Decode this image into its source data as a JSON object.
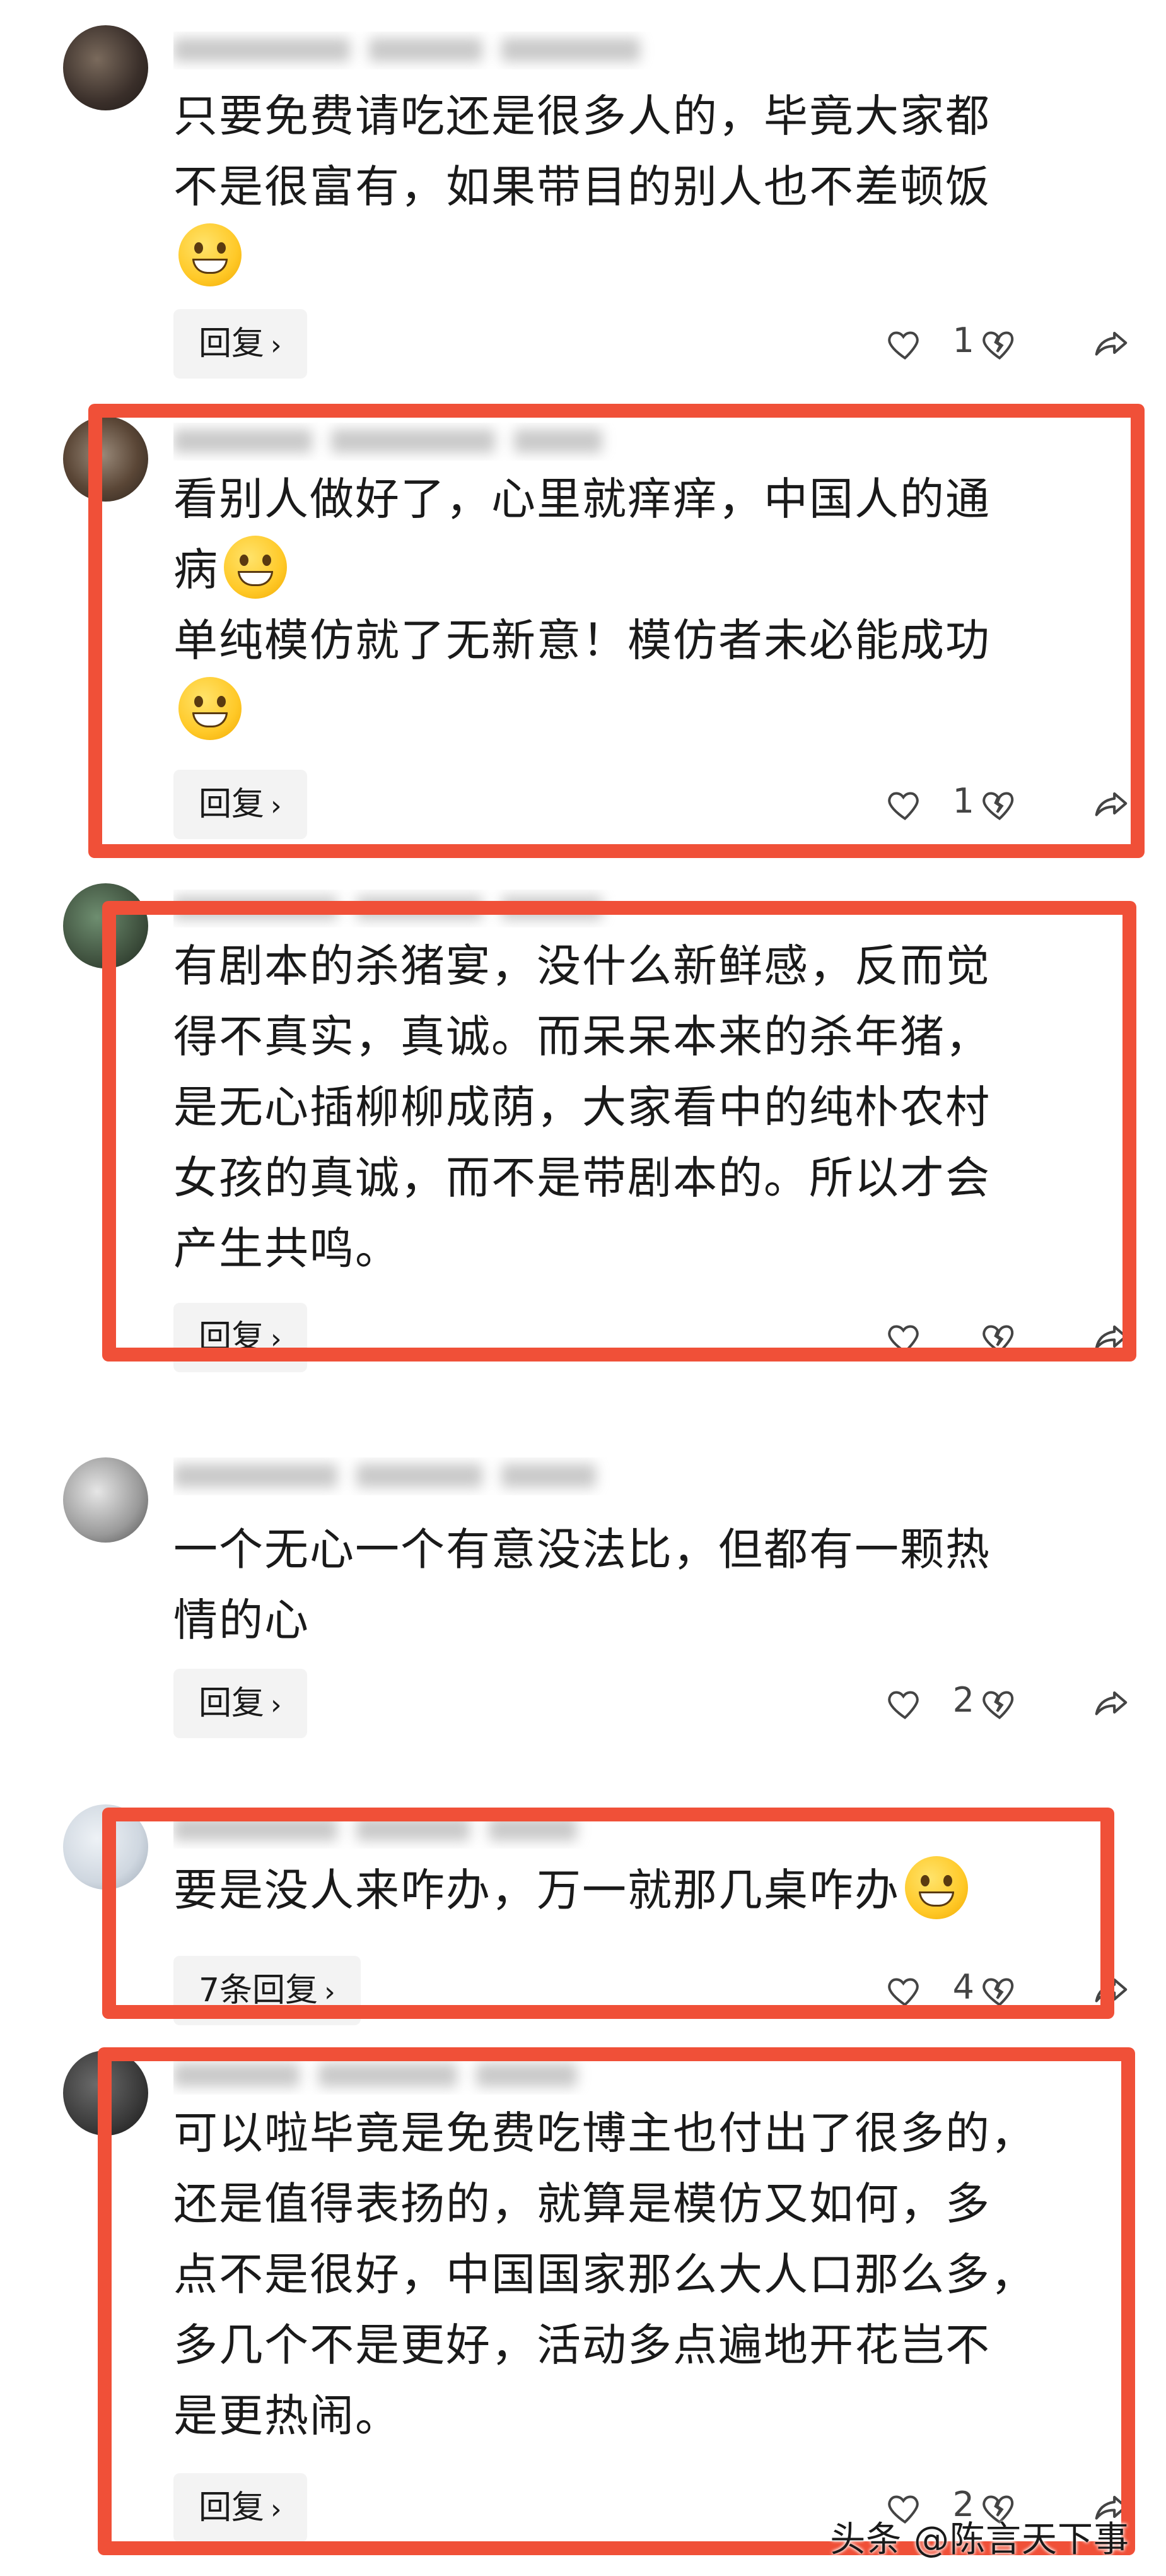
{
  "comments": [
    {
      "text_lines": [
        "只要免费请吃还是很多人的，毕竟大家都",
        "不是很富有，如果带目的别人也不差顿饭"
      ],
      "reply_label": "回复",
      "likes": "1"
    },
    {
      "text_lines": [
        "看别人做好了，心里就痒痒，中国人的通",
        "病",
        "单纯模仿就了无新意！模仿者未必能成功"
      ],
      "reply_label": "回复",
      "likes": "1"
    },
    {
      "text_lines": [
        "有剧本的杀猪宴，没什么新鲜感，反而觉",
        "得不真实，真诚。而呆呆本来的杀年猪，",
        "是无心插柳柳成荫，大家看中的纯朴农村",
        "女孩的真诚，而不是带剧本的。所以才会",
        "产生共鸣。"
      ],
      "reply_label": "回复",
      "likes": ""
    },
    {
      "text_lines": [
        "一个无心一个有意没法比，但都有一颗热",
        "情的心"
      ],
      "reply_label": "回复",
      "likes": "2"
    },
    {
      "text_lines": [
        "要是没人来咋办，万一就那几桌咋办"
      ],
      "reply_label": "7条回复",
      "likes": "4"
    },
    {
      "text_lines": [
        "可以啦毕竟是免费吃博主也付出了很多的，",
        "还是值得表扬的，就算是模仿又如何，多",
        "点不是很好，中国国家那么大人口那么多，",
        "多几个不是更好，活动多点遍地开花岂不",
        "是更热闹。"
      ],
      "reply_label": "回复",
      "likes": "2"
    }
  ],
  "icons": {
    "like": "heart-outline-icon",
    "dislike": "broken-heart-icon",
    "share": "share-arrow-icon",
    "emoji": "grinning-emoji-icon"
  },
  "highlight_color": "#f05038",
  "watermark": "头条 @陈言天下事"
}
